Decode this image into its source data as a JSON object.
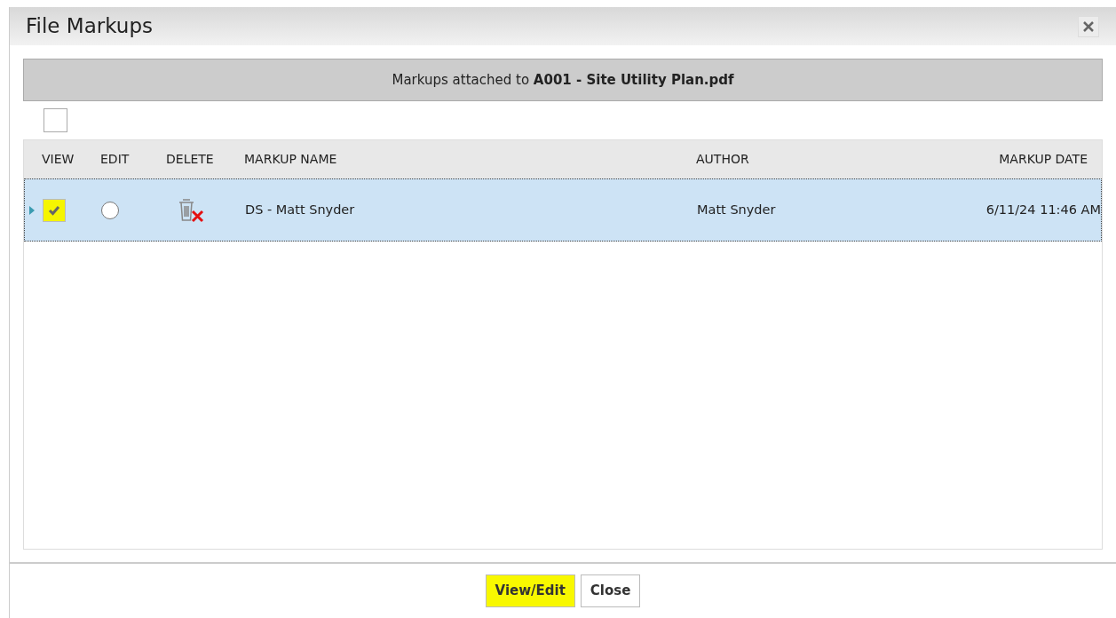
{
  "dialog": {
    "title": "File Markups"
  },
  "banner": {
    "text": "Markups attached to **A001 - Site Utility Plan.pdf**"
  },
  "select_all": {
    "checked": false
  },
  "columns": [
    "VIEW",
    "EDIT",
    "DELETE",
    "MARKUP NAME",
    "AUTHOR",
    "MARKUP DATE"
  ],
  "rows": [
    {
      "selected": true,
      "view_checked": true,
      "view_highlighted": true,
      "edit_selected": false,
      "name": "DS - Matt Snyder",
      "author": "Matt Snyder",
      "date": "6/11/24 11:46 AM"
    }
  ],
  "buttons": [
    {
      "label": "View/Edit",
      "highlighted": true
    },
    {
      "label": "Close",
      "highlighted": false
    }
  ]
}
